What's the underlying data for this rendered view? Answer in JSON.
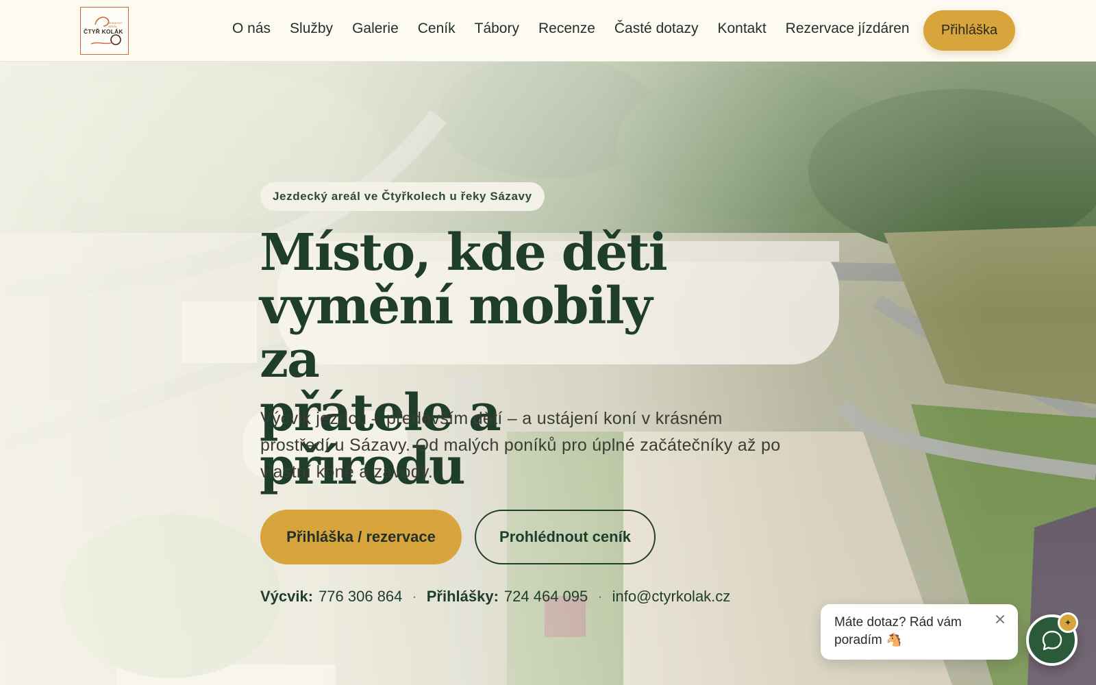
{
  "header": {
    "logo_text": "ČTYŘ KOLÁK",
    "logo_small": "JEZDECKÝ AREÁL",
    "nav": [
      "O nás",
      "Služby",
      "Galerie",
      "Ceník",
      "Tábory",
      "Recenze",
      "Časté dotazy",
      "Kontakt",
      "Rezervace jízdáren"
    ],
    "cta_label": "Přihláška"
  },
  "hero": {
    "badge": "Jezdecký areál ve Čtyřkolech u řeky Sázavy",
    "title_line1": "Místo, kde děti",
    "title_line2": "vymění mobily za",
    "title_line3": "přátele a přírodu",
    "subtitle": "Výcvik jezdců – především dětí – a ustájení koní v krásném prostředí u Sázavy. Od malých poníků pro úplné začátečníky až po vlastní koně a závody.",
    "primary_button": "Přihláška / rezervace",
    "secondary_button": "Prohlédnout ceník",
    "contacts": {
      "training_label": "Výcvik:",
      "training_phone": "776 306 864",
      "applications_label": "Přihlášky:",
      "applications_phone": "724 464 095",
      "email": "info@ctyrkolak.cz",
      "separator": "·"
    }
  },
  "chat": {
    "message": "Máte dotaz? Rád vám poradím 🐴",
    "close_icon": "close-icon",
    "fab_icon": "chat-bubble-icon",
    "badge_icon": "sparkle-icon"
  },
  "colors": {
    "accent": "#d8a43c",
    "primary_green": "#1f3d2b",
    "header_bg": "#fcfaf1"
  }
}
